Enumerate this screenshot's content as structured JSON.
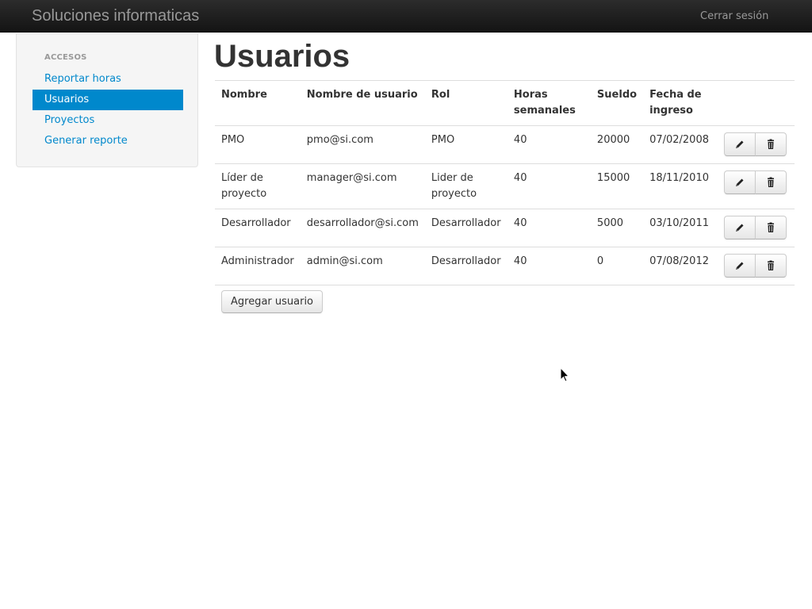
{
  "navbar": {
    "brand": "Soluciones informaticas",
    "logout_label": "Cerrar sesión"
  },
  "sidebar": {
    "header": "ACCESOS",
    "items": [
      {
        "label": "Reportar horas",
        "active": false
      },
      {
        "label": "Usuarios",
        "active": true
      },
      {
        "label": "Proyectos",
        "active": false
      },
      {
        "label": "Generar reporte",
        "active": false
      }
    ]
  },
  "main": {
    "title": "Usuarios",
    "table": {
      "columns": [
        "Nombre",
        "Nombre de usuario",
        "Rol",
        "Horas semanales",
        "Sueldo",
        "Fecha de ingreso"
      ],
      "rows": [
        {
          "nombre": "PMO",
          "usuario": "pmo@si.com",
          "rol": "PMO",
          "horas": "40",
          "sueldo": "20000",
          "fecha": "07/02/2008"
        },
        {
          "nombre": "Líder de proyecto",
          "usuario": "manager@si.com",
          "rol": "Lider de proyecto",
          "horas": "40",
          "sueldo": "15000",
          "fecha": "18/11/2010"
        },
        {
          "nombre": "Desarrollador",
          "usuario": "desarrollador@si.com",
          "rol": "Desarrollador",
          "horas": "40",
          "sueldo": "5000",
          "fecha": "03/10/2011"
        },
        {
          "nombre": "Administrador",
          "usuario": "admin@si.com",
          "rol": "Desarrollador",
          "horas": "40",
          "sueldo": "0",
          "fecha": "07/08/2012"
        }
      ],
      "row_actions": [
        "pencil-icon",
        "trash-icon"
      ]
    },
    "add_button_label": "Agregar usuario"
  },
  "colors": {
    "navbar_bg": "#1b1b1b",
    "accent": "#0088cc",
    "muted": "#999999"
  }
}
